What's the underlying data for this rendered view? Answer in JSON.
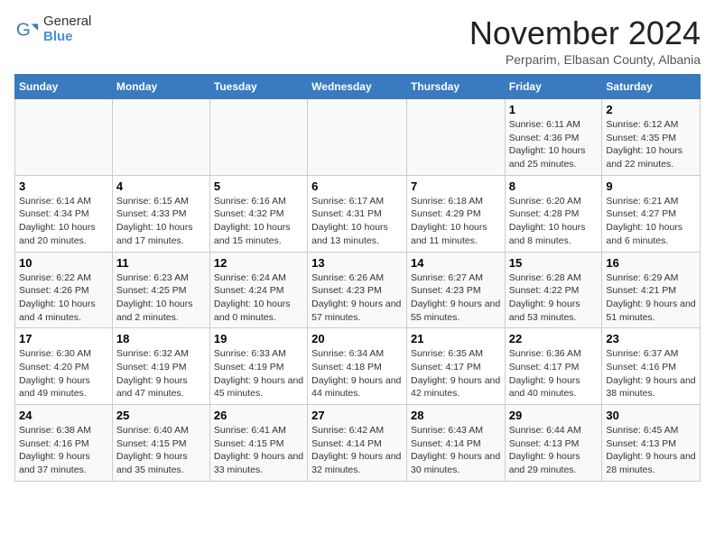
{
  "logo": {
    "general": "General",
    "blue": "Blue"
  },
  "title": "November 2024",
  "subtitle": "Perparim, Elbasan County, Albania",
  "days_of_week": [
    "Sunday",
    "Monday",
    "Tuesday",
    "Wednesday",
    "Thursday",
    "Friday",
    "Saturday"
  ],
  "weeks": [
    [
      {
        "day": "",
        "info": ""
      },
      {
        "day": "",
        "info": ""
      },
      {
        "day": "",
        "info": ""
      },
      {
        "day": "",
        "info": ""
      },
      {
        "day": "",
        "info": ""
      },
      {
        "day": "1",
        "info": "Sunrise: 6:11 AM\nSunset: 4:36 PM\nDaylight: 10 hours and 25 minutes."
      },
      {
        "day": "2",
        "info": "Sunrise: 6:12 AM\nSunset: 4:35 PM\nDaylight: 10 hours and 22 minutes."
      }
    ],
    [
      {
        "day": "3",
        "info": "Sunrise: 6:14 AM\nSunset: 4:34 PM\nDaylight: 10 hours and 20 minutes."
      },
      {
        "day": "4",
        "info": "Sunrise: 6:15 AM\nSunset: 4:33 PM\nDaylight: 10 hours and 17 minutes."
      },
      {
        "day": "5",
        "info": "Sunrise: 6:16 AM\nSunset: 4:32 PM\nDaylight: 10 hours and 15 minutes."
      },
      {
        "day": "6",
        "info": "Sunrise: 6:17 AM\nSunset: 4:31 PM\nDaylight: 10 hours and 13 minutes."
      },
      {
        "day": "7",
        "info": "Sunrise: 6:18 AM\nSunset: 4:29 PM\nDaylight: 10 hours and 11 minutes."
      },
      {
        "day": "8",
        "info": "Sunrise: 6:20 AM\nSunset: 4:28 PM\nDaylight: 10 hours and 8 minutes."
      },
      {
        "day": "9",
        "info": "Sunrise: 6:21 AM\nSunset: 4:27 PM\nDaylight: 10 hours and 6 minutes."
      }
    ],
    [
      {
        "day": "10",
        "info": "Sunrise: 6:22 AM\nSunset: 4:26 PM\nDaylight: 10 hours and 4 minutes."
      },
      {
        "day": "11",
        "info": "Sunrise: 6:23 AM\nSunset: 4:25 PM\nDaylight: 10 hours and 2 minutes."
      },
      {
        "day": "12",
        "info": "Sunrise: 6:24 AM\nSunset: 4:24 PM\nDaylight: 10 hours and 0 minutes."
      },
      {
        "day": "13",
        "info": "Sunrise: 6:26 AM\nSunset: 4:23 PM\nDaylight: 9 hours and 57 minutes."
      },
      {
        "day": "14",
        "info": "Sunrise: 6:27 AM\nSunset: 4:23 PM\nDaylight: 9 hours and 55 minutes."
      },
      {
        "day": "15",
        "info": "Sunrise: 6:28 AM\nSunset: 4:22 PM\nDaylight: 9 hours and 53 minutes."
      },
      {
        "day": "16",
        "info": "Sunrise: 6:29 AM\nSunset: 4:21 PM\nDaylight: 9 hours and 51 minutes."
      }
    ],
    [
      {
        "day": "17",
        "info": "Sunrise: 6:30 AM\nSunset: 4:20 PM\nDaylight: 9 hours and 49 minutes."
      },
      {
        "day": "18",
        "info": "Sunrise: 6:32 AM\nSunset: 4:19 PM\nDaylight: 9 hours and 47 minutes."
      },
      {
        "day": "19",
        "info": "Sunrise: 6:33 AM\nSunset: 4:19 PM\nDaylight: 9 hours and 45 minutes."
      },
      {
        "day": "20",
        "info": "Sunrise: 6:34 AM\nSunset: 4:18 PM\nDaylight: 9 hours and 44 minutes."
      },
      {
        "day": "21",
        "info": "Sunrise: 6:35 AM\nSunset: 4:17 PM\nDaylight: 9 hours and 42 minutes."
      },
      {
        "day": "22",
        "info": "Sunrise: 6:36 AM\nSunset: 4:17 PM\nDaylight: 9 hours and 40 minutes."
      },
      {
        "day": "23",
        "info": "Sunrise: 6:37 AM\nSunset: 4:16 PM\nDaylight: 9 hours and 38 minutes."
      }
    ],
    [
      {
        "day": "24",
        "info": "Sunrise: 6:38 AM\nSunset: 4:16 PM\nDaylight: 9 hours and 37 minutes."
      },
      {
        "day": "25",
        "info": "Sunrise: 6:40 AM\nSunset: 4:15 PM\nDaylight: 9 hours and 35 minutes."
      },
      {
        "day": "26",
        "info": "Sunrise: 6:41 AM\nSunset: 4:15 PM\nDaylight: 9 hours and 33 minutes."
      },
      {
        "day": "27",
        "info": "Sunrise: 6:42 AM\nSunset: 4:14 PM\nDaylight: 9 hours and 32 minutes."
      },
      {
        "day": "28",
        "info": "Sunrise: 6:43 AM\nSunset: 4:14 PM\nDaylight: 9 hours and 30 minutes."
      },
      {
        "day": "29",
        "info": "Sunrise: 6:44 AM\nSunset: 4:13 PM\nDaylight: 9 hours and 29 minutes."
      },
      {
        "day": "30",
        "info": "Sunrise: 6:45 AM\nSunset: 4:13 PM\nDaylight: 9 hours and 28 minutes."
      }
    ]
  ]
}
